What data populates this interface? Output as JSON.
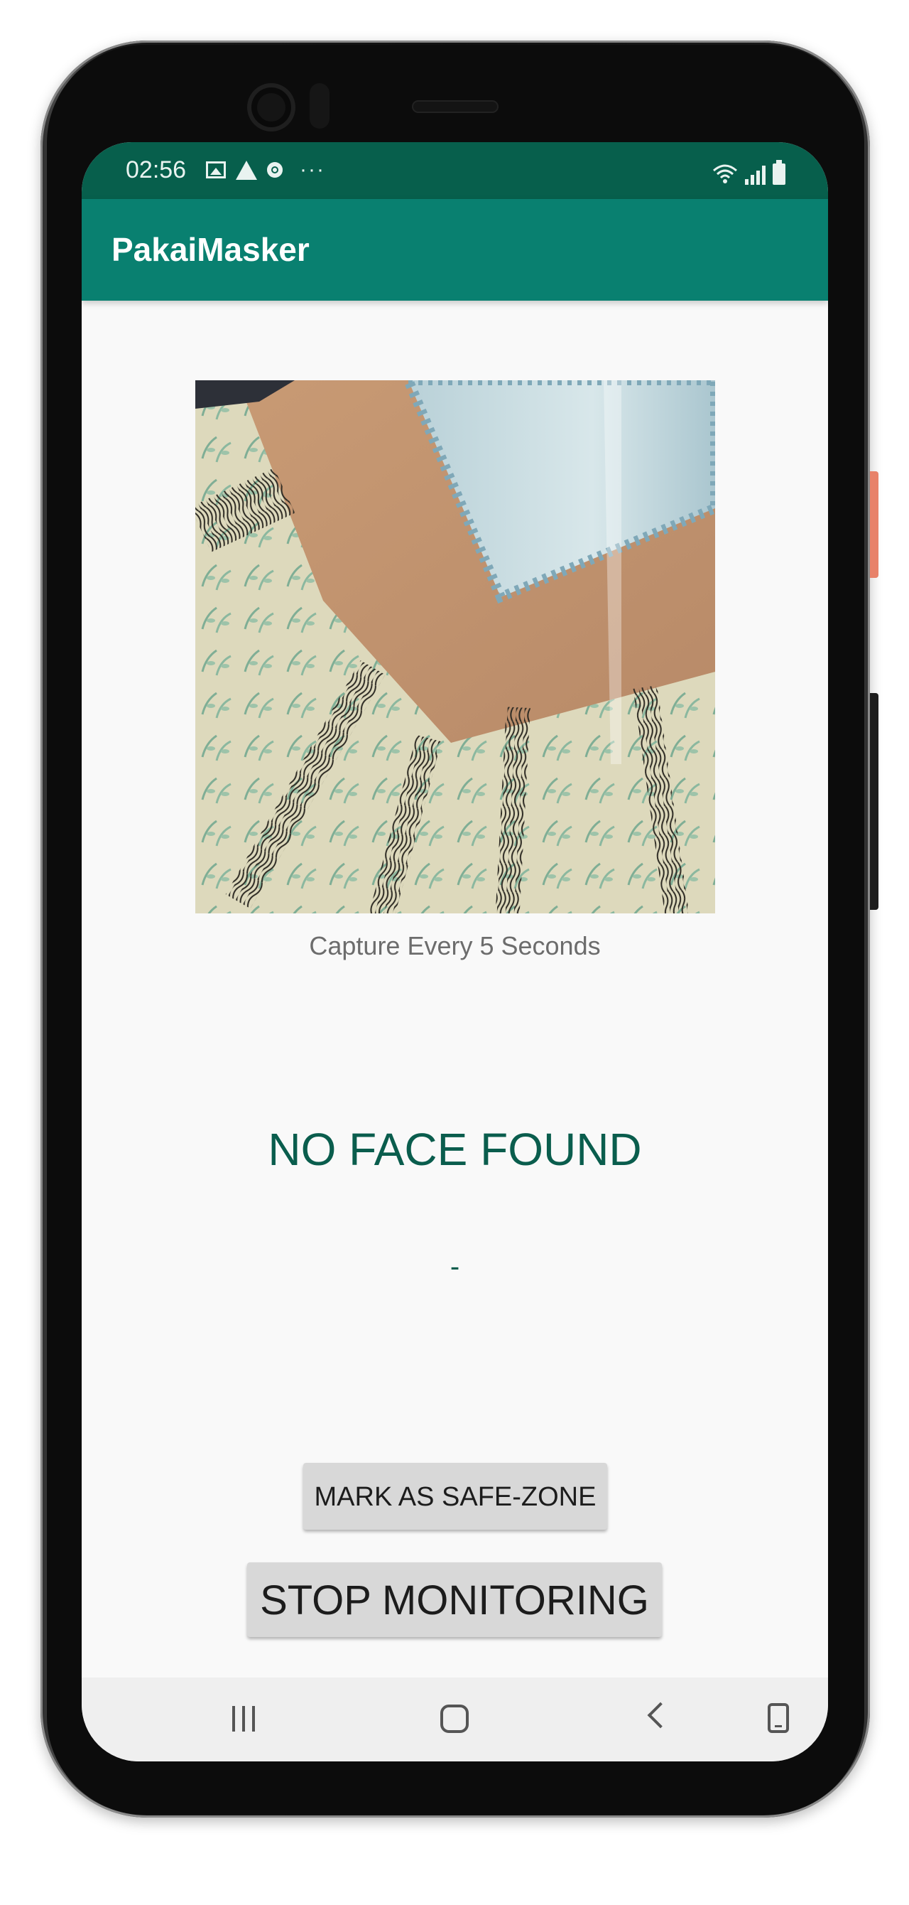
{
  "status_bar": {
    "time": "02:56",
    "left_icons": [
      "gallery-icon",
      "warning-icon",
      "notification-dot-icon",
      "more-notifications-icon"
    ],
    "more_label": "···",
    "right_icons": [
      "wifi-icon",
      "signal-icon",
      "battery-icon"
    ]
  },
  "app_bar": {
    "title": "PakaiMasker"
  },
  "camera": {
    "caption": "Capture Every 5 Seconds"
  },
  "result": {
    "title": "NO FACE FOUND",
    "detail": "-"
  },
  "buttons": {
    "safe_zone": "MARK AS SAFE-ZONE",
    "stop": "STOP MONITORING"
  },
  "nav": {
    "icons": [
      "recent-apps-icon",
      "home-icon",
      "back-icon",
      "assistant-icon"
    ]
  },
  "colors": {
    "status_bar": "#075f4c",
    "app_bar": "#098070",
    "accent_text": "#0a5d4d",
    "screen_bg": "#f9f9f9",
    "button_bg": "#d8d8d8"
  }
}
